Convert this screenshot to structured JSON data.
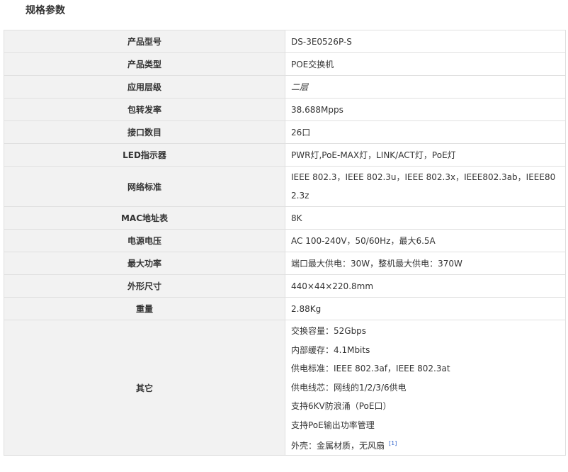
{
  "section": {
    "title": "规格参数"
  },
  "specs": {
    "rows": [
      {
        "label": "产品型号",
        "value": "DS-3E0526P-S"
      },
      {
        "label": "产品类型",
        "value": "POE交换机"
      },
      {
        "label": "应用层级",
        "value": "二层"
      },
      {
        "label": "包转发率",
        "value": "38.688Mpps"
      },
      {
        "label": "接口数目",
        "value": "26口"
      },
      {
        "label": "LED指示器",
        "value": "PWR灯,PoE-MAX灯，LINK/ACT灯，PoE灯"
      },
      {
        "label": "网络标准",
        "value": "IEEE 802.3，IEEE 802.3u，IEEE 802.3x，IEEE802.3ab，IEEE802.3z"
      },
      {
        "label": "MAC地址表",
        "value": "8K"
      },
      {
        "label": "电源电压",
        "value": "AC 100-240V，50/60Hz，最大6.5A"
      },
      {
        "label": "最大功率",
        "value": "端口最大供电：30W，整机最大供电：370W"
      },
      {
        "label": "外形尺寸",
        "value": "440×44×220.8mm"
      },
      {
        "label": "重量",
        "value": "2.88Kg"
      }
    ],
    "other": {
      "label": "其它",
      "lines": [
        "交换容量：52Gbps",
        "内部缓存：4.1Mbits",
        "供电标准：IEEE 802.3af，IEEE 802.3at",
        "供电线芯：网线的1/2/3/6供电",
        "支持6KV防浪涌（PoE口）",
        "支持PoE输出功率管理",
        "外壳：金属材质，无风扇"
      ],
      "ref": "[1]"
    }
  }
}
